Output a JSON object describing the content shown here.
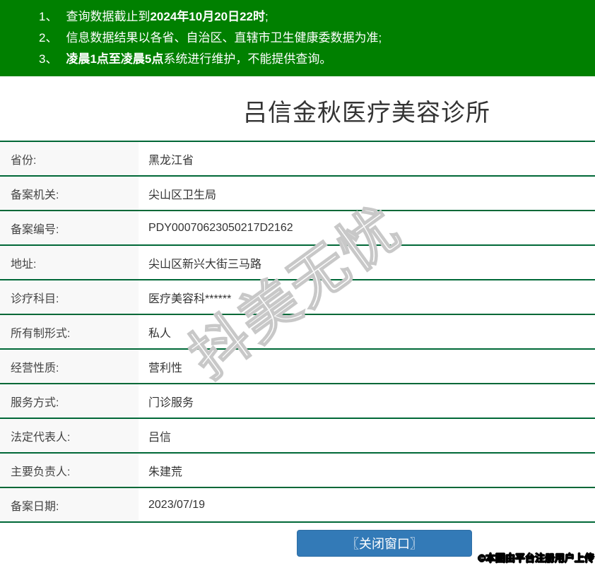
{
  "notice": {
    "lines": [
      {
        "num": "1、",
        "pre": "查询数据截止到",
        "bold": "2024年10月20日22时",
        "post": ";"
      },
      {
        "num": "2、",
        "pre": "信息数据结果以各省、自治区、直辖市卫生健康委数据为准;",
        "bold": "",
        "post": ""
      },
      {
        "num": "3、",
        "pre": "",
        "bold": "凌晨1点至凌晨5点",
        "post": "系统进行维护，不能提供查询。"
      }
    ]
  },
  "clinic": {
    "title": "吕信金秋医疗美容诊所"
  },
  "table": {
    "rows": [
      {
        "label": "省份:",
        "value": "黑龙江省"
      },
      {
        "label": "备案机关:",
        "value": "尖山区卫生局"
      },
      {
        "label": "备案编号:",
        "value": "PDY00070623050217D2162"
      },
      {
        "label": "地址:",
        "value": "尖山区新兴大街三马路"
      },
      {
        "label": "诊疗科目:",
        "value": "医疗美容科******"
      },
      {
        "label": "所有制形式:",
        "value": "私人"
      },
      {
        "label": "经营性质:",
        "value": "营利性"
      },
      {
        "label": "服务方式:",
        "value": "门诊服务"
      },
      {
        "label": "法定代表人:",
        "value": "吕信"
      },
      {
        "label": "主要负责人:",
        "value": "朱建荒"
      },
      {
        "label": "备案日期:",
        "value": "2023/07/19"
      }
    ]
  },
  "footer": {
    "close_button_label": "〖关闭窗口〗",
    "attribution": "©本图由平台注册用户上传"
  },
  "watermark": {
    "text": "抖美无忧"
  },
  "colors": {
    "banner_green": "#008000",
    "divider_green": "#006837",
    "label_bg": "#f8f8f8",
    "button_blue": "#337ab7",
    "button_border": "#2e6da4",
    "watermark_stroke": "#c8c8c8"
  }
}
